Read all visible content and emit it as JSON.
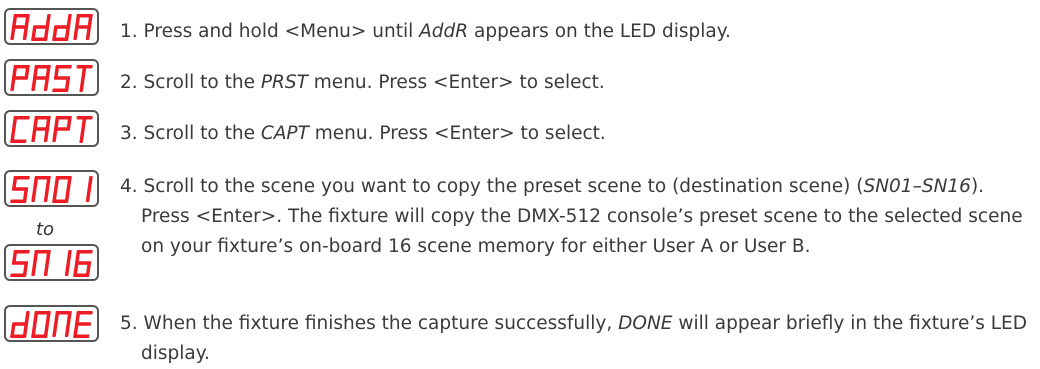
{
  "displays": [
    {
      "name": "addr",
      "text": "AddR"
    },
    {
      "name": "prst",
      "text": "PRST"
    },
    {
      "name": "capt",
      "text": "CAPT"
    },
    {
      "name": "sn01",
      "text": "SN01"
    },
    {
      "name": "sn16",
      "text": "SN16"
    },
    {
      "name": "done",
      "text": "dONE"
    }
  ],
  "range_connector": "to",
  "led_color": "#ee1c25",
  "steps": [
    {
      "num": "1.",
      "parts": [
        "Press and hold <Menu> until ",
        "AddR",
        " appears on the LED display."
      ]
    },
    {
      "num": "2.",
      "parts": [
        "Scroll to the ",
        "PRST",
        " menu. Press <Enter> to select."
      ]
    },
    {
      "num": "3.",
      "parts": [
        "Scroll to the ",
        "CAPT",
        " menu. Press <Enter> to select."
      ]
    },
    {
      "num": "4.",
      "parts": [
        "Scroll to the scene you want to copy the preset scene to (destination scene) (",
        "SN01–SN16",
        "). Press <Enter>. The fixture will copy the DMX-512 console’s preset scene to the selected scene on your fixture’s on-board 16 scene memory for either User A or User B."
      ]
    },
    {
      "num": "5.",
      "parts": [
        "When the fixture finishes the capture successfully, ",
        "DONE",
        " will appear briefly in the fixture’s LED display."
      ]
    }
  ]
}
